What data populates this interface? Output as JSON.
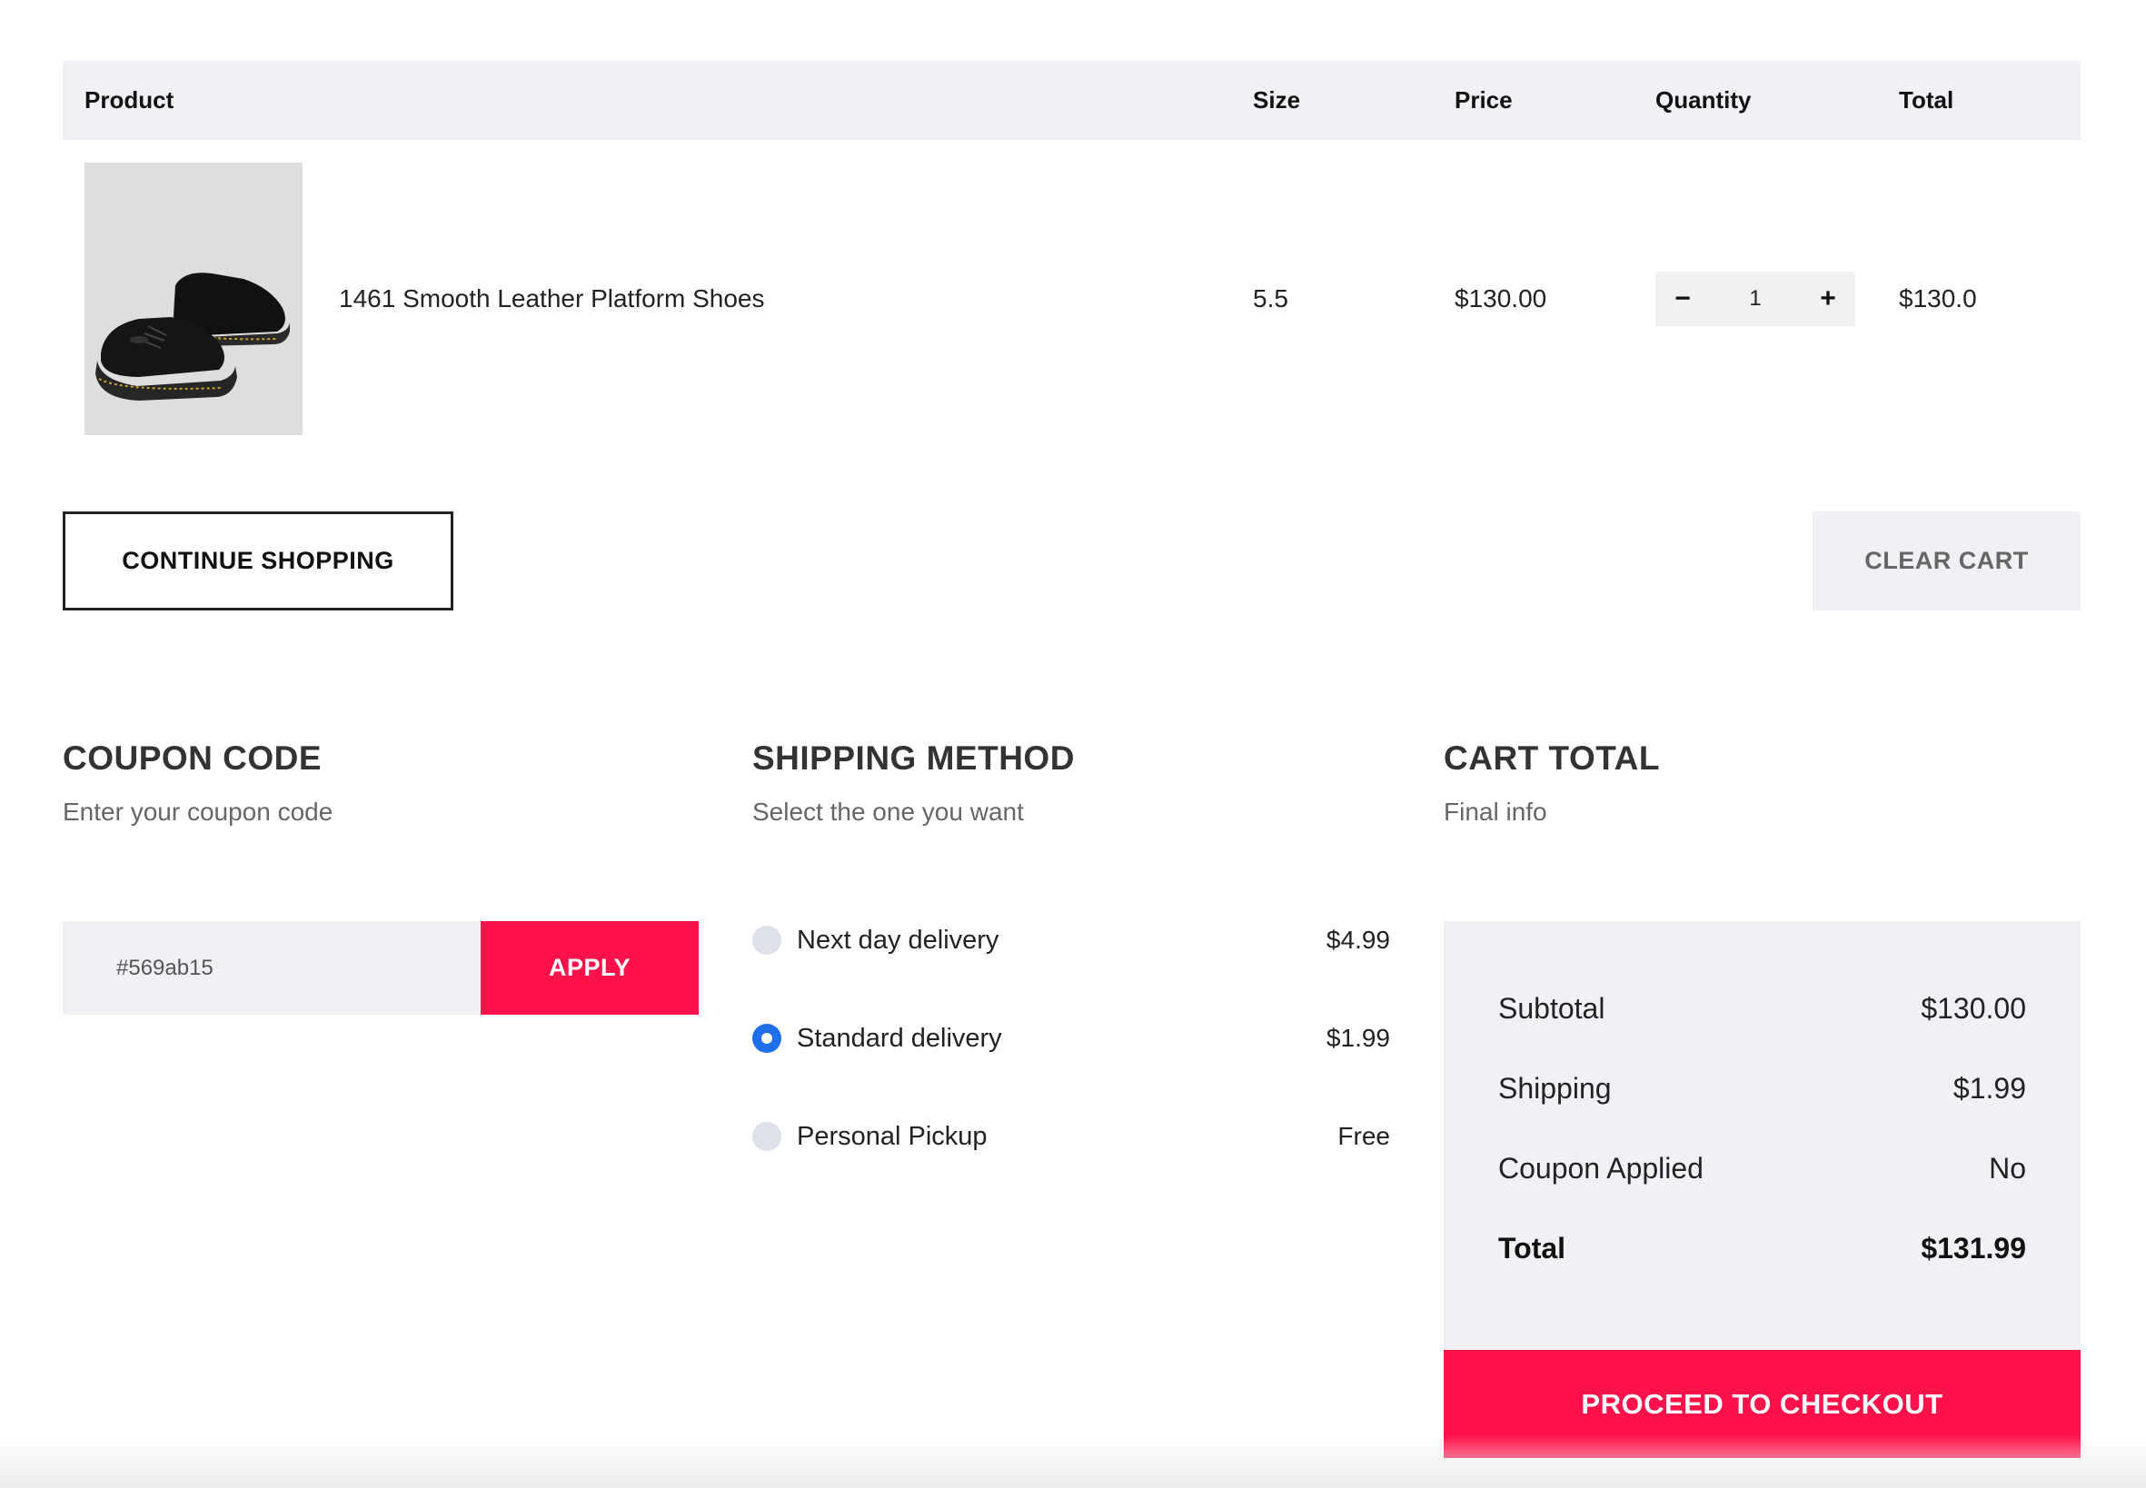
{
  "cart_table": {
    "headers": {
      "product": "Product",
      "size": "Size",
      "price": "Price",
      "quantity": "Quantity",
      "total": "Total"
    },
    "items": [
      {
        "name": "1461 Smooth Leather Platform Shoes",
        "size": "5.5",
        "price": "$130.00",
        "quantity": "1",
        "total": "$130.0",
        "image_icon": "shoe-photo"
      }
    ],
    "qty_decrement_symbol": "−",
    "qty_increment_symbol": "+"
  },
  "actions": {
    "continue_label": "CONTINUE SHOPPING",
    "clear_label": "CLEAR CART"
  },
  "coupon": {
    "title": "COUPON CODE",
    "subtitle": "Enter your coupon code",
    "placeholder": "#569ab15",
    "apply_label": "APPLY"
  },
  "shipping": {
    "title": "SHIPPING METHOD",
    "subtitle": "Select the one you want",
    "options": [
      {
        "label": "Next day delivery",
        "price": "$4.99",
        "selected": false
      },
      {
        "label": "Standard delivery",
        "price": "$1.99",
        "selected": true
      },
      {
        "label": "Personal Pickup",
        "price": "Free",
        "selected": false
      }
    ]
  },
  "cart_total": {
    "title": "CART TOTAL",
    "subtitle": "Final info",
    "rows": [
      {
        "label": "Subtotal",
        "value": "$130.00"
      },
      {
        "label": "Shipping",
        "value": "$1.99"
      },
      {
        "label": "Coupon Applied",
        "value": "No"
      },
      {
        "label": "Total",
        "value": "$131.99"
      }
    ],
    "checkout_label": "PROCEED TO CHECKOUT"
  },
  "colors": {
    "accent": "#ff1249",
    "panel_bg": "#f0f0f5",
    "radio_selected": "#1f6feb",
    "radio_unselected": "#dde1e8"
  }
}
